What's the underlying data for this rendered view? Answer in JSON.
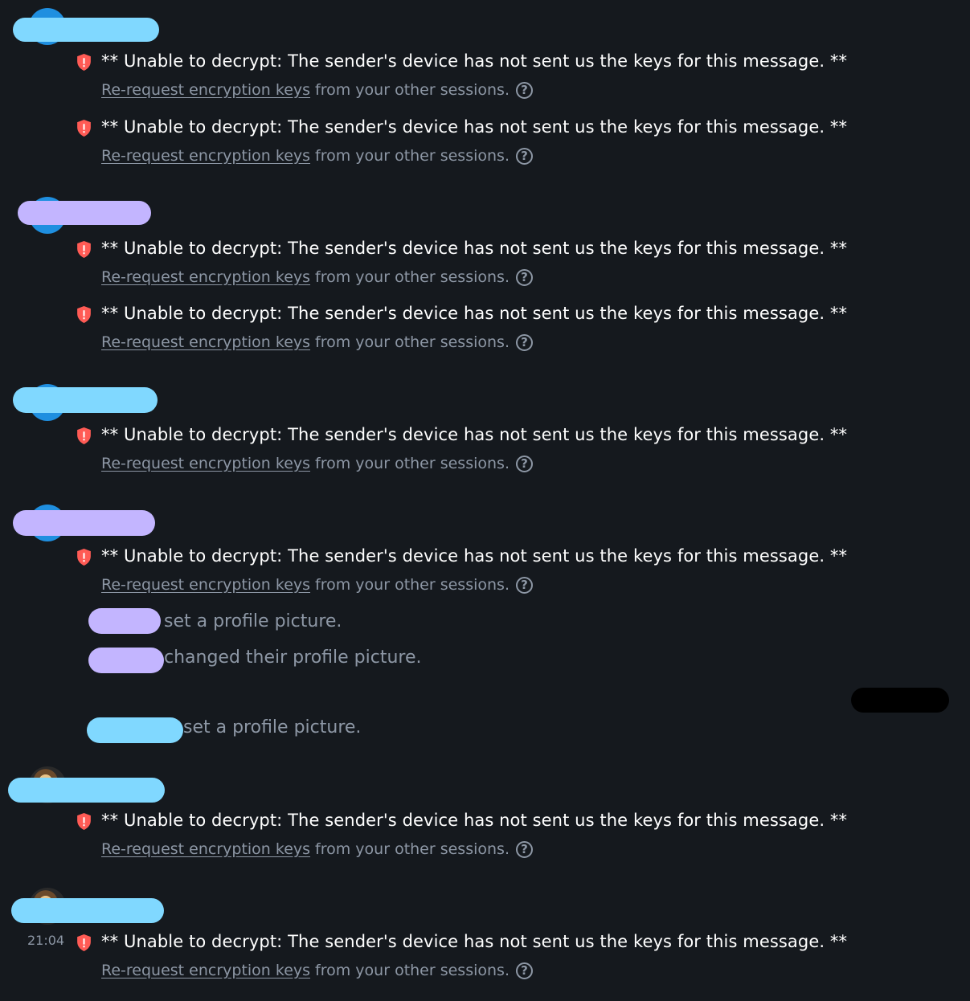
{
  "colors": {
    "background": "#15191e",
    "text": "#ffffff",
    "secondary_text": "#8d97a5",
    "warning_shield": "#ff5b55",
    "redact_cyan": "#80d8ff",
    "redact_lavender": "#c3b5ff",
    "avatar_blue": "#1f8fe0"
  },
  "icons": {
    "shield": "shield-alert-icon",
    "help": "question-circle-icon"
  },
  "utd": {
    "message": "** Unable to decrypt: The sender's device has not sent us the keys for this message. **",
    "rerequest_link": "Re-request encryption keys",
    "rerequest_suffix": "from your other sessions.",
    "help_glyph": "?"
  },
  "state_events": {
    "set_profile_picture": "set a profile picture.",
    "changed_profile_picture": "changed their profile picture."
  },
  "timestamp": "21:04"
}
